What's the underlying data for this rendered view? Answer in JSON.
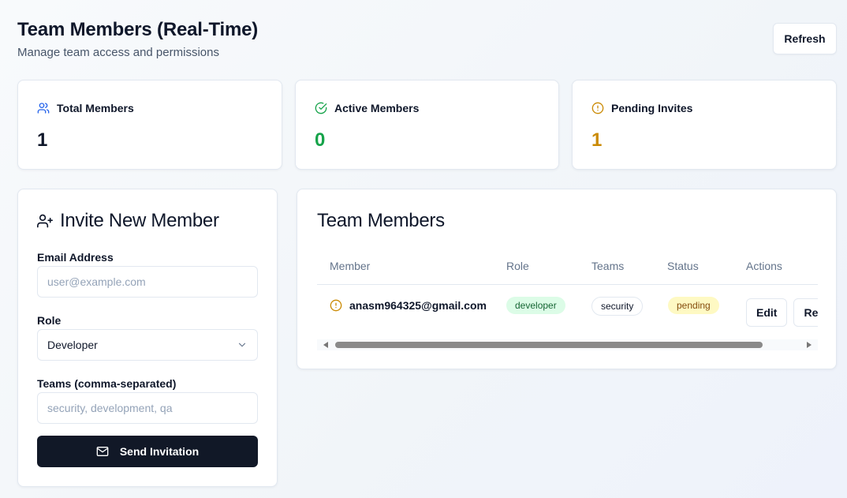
{
  "header": {
    "title": "Team Members (Real-Time)",
    "subtitle": "Manage team access and permissions",
    "refresh_label": "Refresh"
  },
  "stats": [
    {
      "label": "Total Members",
      "value": "1",
      "icon": "users-icon",
      "color": "#0f172a",
      "icon_color": "#2563eb"
    },
    {
      "label": "Active Members",
      "value": "0",
      "icon": "check-circle-icon",
      "color": "#16a34a",
      "icon_color": "#16a34a"
    },
    {
      "label": "Pending Invites",
      "value": "1",
      "icon": "alert-circle-icon",
      "color": "#ca8a04",
      "icon_color": "#ca8a04"
    }
  ],
  "invite": {
    "title": "Invite New Member",
    "email_label": "Email Address",
    "email_placeholder": "user@example.com",
    "role_label": "Role",
    "role_value": "Developer",
    "teams_label": "Teams (comma-separated)",
    "teams_placeholder": "security, development, qa",
    "send_label": "Send Invitation"
  },
  "members": {
    "title": "Team Members",
    "columns": [
      "Member",
      "Role",
      "Teams",
      "Status",
      "Actions"
    ],
    "rows": [
      {
        "email": "anasm964325@gmail.com",
        "role": "developer",
        "team": "security",
        "status": "pending",
        "actions": [
          "Edit",
          "Resend"
        ]
      }
    ]
  },
  "colors": {
    "primary_button": "#111827",
    "role_badge_bg": "#dcfce7",
    "status_badge_bg": "#fef9c3",
    "border": "#e2e8f0"
  }
}
